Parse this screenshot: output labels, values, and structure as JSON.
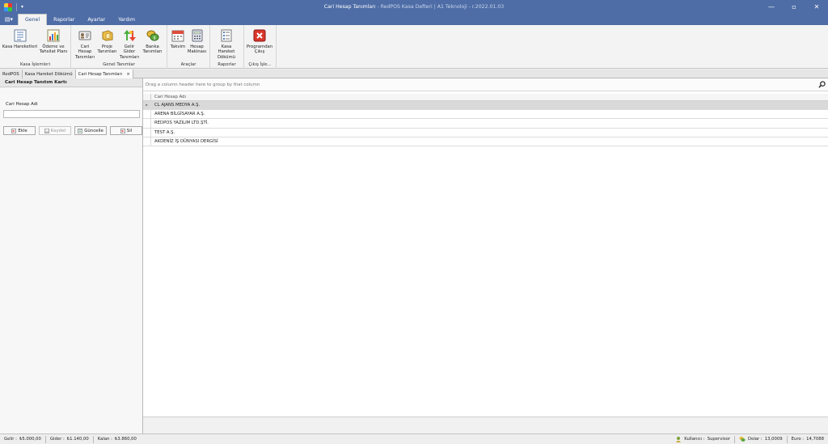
{
  "window": {
    "title": "Cari Hesap Tanımları",
    "app_name": "- RedPOS Kasa Defteri",
    "company": "| A1 Teknoloji",
    "version": "- r.2022.01.03",
    "minimize": "—",
    "maximize": "▫",
    "close": "✕"
  },
  "ribbon_tabs": [
    "Genel",
    "Raporlar",
    "Ayarlar",
    "Yardım"
  ],
  "ribbon": {
    "groups": [
      {
        "title": "Kasa İşlemleri",
        "buttons": [
          {
            "label": "Kasa Hareketleri",
            "icon": "cash-movements-icon"
          },
          {
            "label": "Ödeme ve\nTahsilat Planı",
            "icon": "chart-icon"
          }
        ]
      },
      {
        "title": "Genel Tanımlar",
        "buttons": [
          {
            "label": "Cari Hesap\nTanımları",
            "icon": "contact-card-icon"
          },
          {
            "label": "Proje\nTanımları",
            "icon": "project-icon"
          },
          {
            "label": "Gelir Gider\nTanımları",
            "icon": "income-expense-icon"
          },
          {
            "label": "Banka\nTanımları",
            "icon": "bank-coins-icon"
          }
        ]
      },
      {
        "title": "Araçlar",
        "buttons": [
          {
            "label": "Takvim",
            "icon": "calendar-icon"
          },
          {
            "label": "Hesap\nMakinası",
            "icon": "calculator-icon"
          }
        ]
      },
      {
        "title": "Raporlar",
        "buttons": [
          {
            "label": "Kasa Hareket\nDökümü",
            "icon": "report-list-icon"
          }
        ]
      },
      {
        "title": "Çıkış İşle...",
        "buttons": [
          {
            "label": "Programdan\nÇıkış",
            "icon": "exit-icon"
          }
        ]
      }
    ]
  },
  "doc_tabs": [
    {
      "label": "RedPOS",
      "active": false
    },
    {
      "label": "Kasa Hareket Dökümü",
      "active": false
    },
    {
      "label": "Cari Hesap Tanımları",
      "active": true,
      "close": "×"
    }
  ],
  "left_panel": {
    "title": "Cari Hesap Tanıtım Kartı",
    "field_label": "Cari Hesap Adi",
    "field_value": "",
    "buttons": {
      "add": "Ekle",
      "save": "Kaydet",
      "update": "Güncelle",
      "delete": "Sil"
    }
  },
  "grid": {
    "group_hint": "Drag a column header here to group by that column",
    "column_header": "Cari Hesap Adı",
    "row_indicator": "▸",
    "rows": [
      "CL AJANS MEDYA A.Ş.",
      "ARENA BİLGİSAYAR A.Ş.",
      "REDPOS YAZILIM LTD.ŞTİ.",
      "TEST A.Ş.",
      "AKDENİZ İŞ DÜNYASI DERGİSİ"
    ]
  },
  "status": {
    "income_label": "Gelir :",
    "income_value": "₺5.000,00",
    "expense_label": "Gider :",
    "expense_value": "₺1.140,00",
    "balance_label": "Kalan :",
    "balance_value": "₺3.860,00",
    "user_label": "Kullanıcı :",
    "user_value": "Supervisor",
    "dollar_label": "Dolar :",
    "dollar_value": "13,0009",
    "euro_label": "Euro :",
    "euro_value": "14,7088"
  }
}
